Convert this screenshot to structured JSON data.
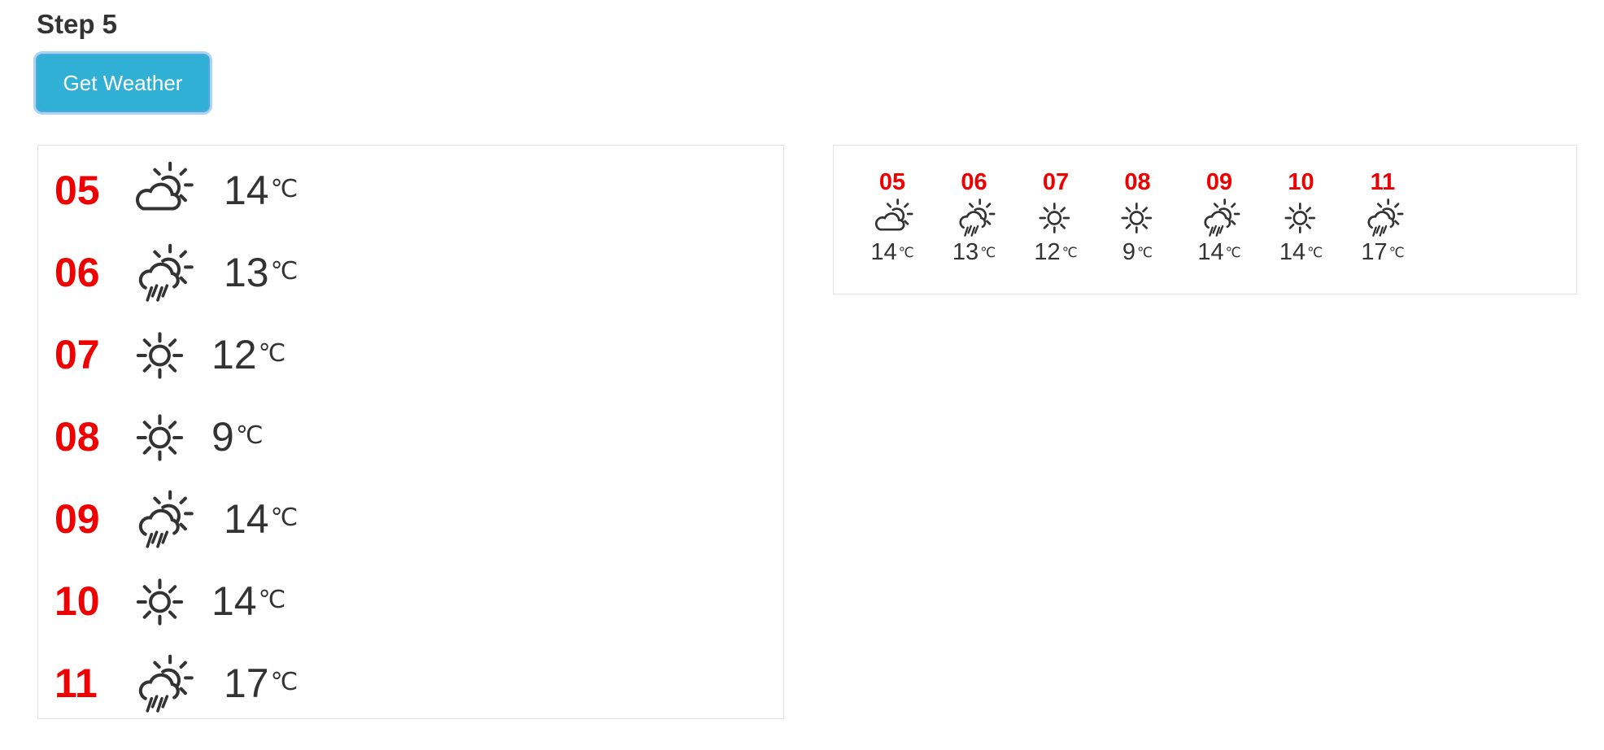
{
  "step_title": "Step 5",
  "button_label": "Get Weather",
  "unit": "℃",
  "forecast": [
    {
      "day": "05",
      "icon": "cloud-sun-icon",
      "temp": "14"
    },
    {
      "day": "06",
      "icon": "rain-cloud-sun-icon",
      "temp": "13"
    },
    {
      "day": "07",
      "icon": "sun-icon",
      "temp": "12"
    },
    {
      "day": "08",
      "icon": "sun-icon",
      "temp": "9"
    },
    {
      "day": "09",
      "icon": "rain-cloud-sun-icon",
      "temp": "14"
    },
    {
      "day": "10",
      "icon": "sun-icon",
      "temp": "14"
    },
    {
      "day": "11",
      "icon": "rain-cloud-sun-icon",
      "temp": "17"
    }
  ],
  "colors": {
    "day_number": "#ee0000",
    "button_bg": "#31b0d5",
    "text": "#333333"
  }
}
